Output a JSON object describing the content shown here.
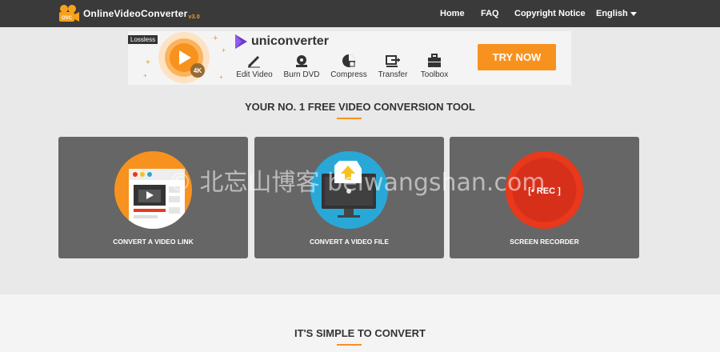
{
  "brand": {
    "name": "OnlineVideoConverter",
    "version": "v3.0",
    "badge": "OVC"
  },
  "nav": {
    "home": "Home",
    "faq": "FAQ",
    "copyright": "Copyright Notice",
    "language": "English"
  },
  "ad": {
    "lossless": "Lossless",
    "resolution": "4K",
    "product": "uniconverter",
    "features": [
      "Edit Video",
      "Burn DVD",
      "Compress",
      "Transfer",
      "Toolbox"
    ],
    "cta": "TRY NOW"
  },
  "main": {
    "headline": "YOUR NO. 1 FREE VIDEO CONVERSION TOOL",
    "cards": [
      {
        "label": "CONVERT A VIDEO LINK",
        "color": "#f7921e"
      },
      {
        "label": "CONVERT A VIDEO FILE",
        "color": "#29a8d8"
      },
      {
        "label": "SCREEN RECORDER",
        "color": "#e8391d",
        "badge": "[• REC ]"
      }
    ]
  },
  "section2": {
    "headline": "IT'S SIMPLE TO CONVERT"
  },
  "watermark": "© 北忘山博客 beiwangshan.com",
  "colors": {
    "accent": "#f7921e",
    "topbar": "#3a3a3a",
    "card": "#666666"
  }
}
